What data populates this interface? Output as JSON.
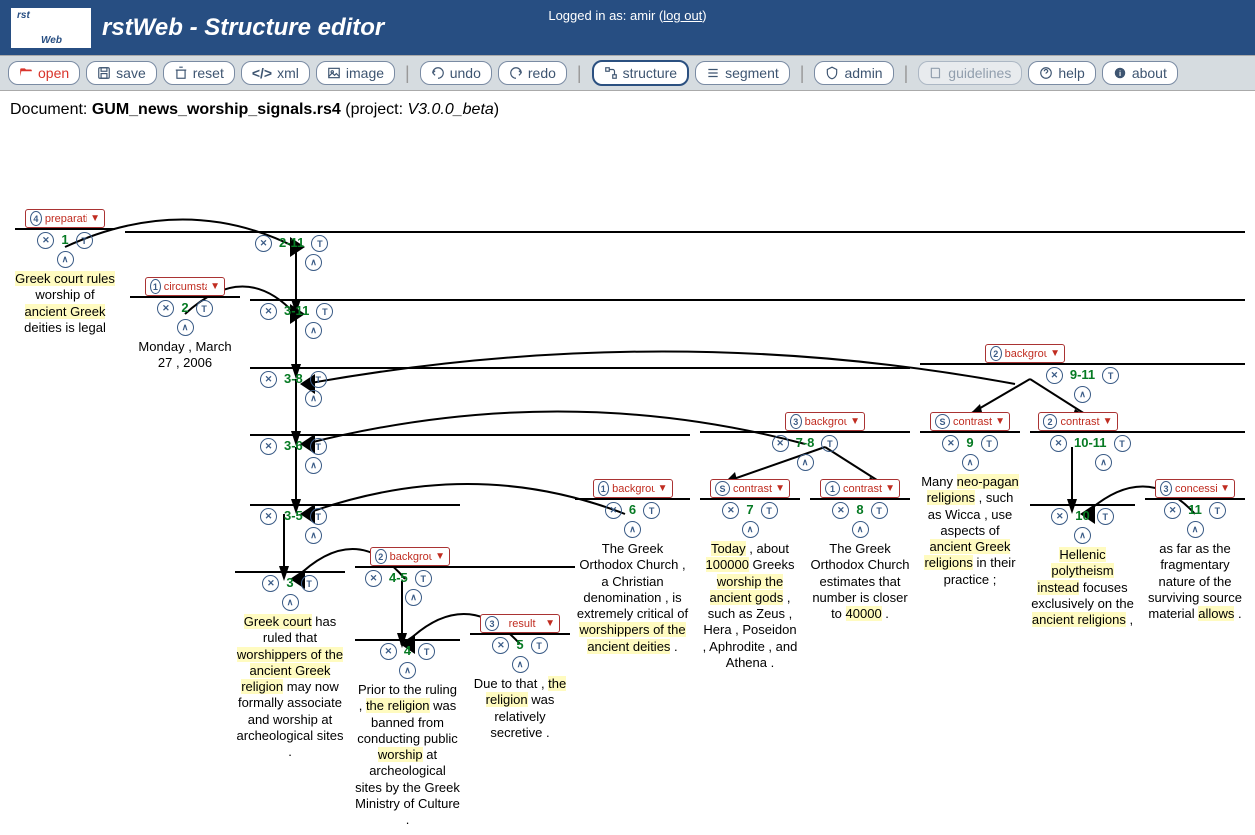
{
  "header": {
    "app_title": "rstWeb - Structure editor",
    "logged_in": "Logged in as: amir (",
    "logout": "log out",
    "close": ")"
  },
  "toolbar": {
    "open": "open",
    "save": "save",
    "reset": "reset",
    "xml": "xml",
    "image": "image",
    "undo": "undo",
    "redo": "redo",
    "structure": "structure",
    "segment": "segment",
    "admin": "admin",
    "guidelines": "guidelines",
    "help": "help",
    "about": "about"
  },
  "doc": {
    "label": "Document: ",
    "name": "GUM_news_worship_signals.rs4",
    "proj_label": " (project: ",
    "proj": "V3.0.0_beta",
    "close": ")"
  },
  "spans": {
    "s1": "1",
    "s2": "2",
    "s2_11": "2-11",
    "s3_11": "3-11",
    "s3_8": "3-8",
    "s9_11": "9-11",
    "s3_6": "3-6",
    "s7_8": "7-8",
    "s9": "9",
    "s10_11": "10-11",
    "s3_5": "3-5",
    "s6": "6",
    "s7": "7",
    "s8": "8",
    "s10": "10",
    "s11": "11",
    "s3": "3",
    "s4_5": "4-5",
    "s4": "4",
    "s5": "5"
  },
  "rel": {
    "preparation": "preparation",
    "circumstance": "circumstance",
    "background": "background",
    "contrast": "contrast",
    "concession": "concession",
    "result": "result"
  },
  "text": {
    "t1a": "Greek court rules",
    "t1b": " worship of ",
    "t1c": "ancient Greek",
    "t1d": " deities is legal",
    "t2": "Monday , March 27 , 2006",
    "t3a": "Greek court",
    "t3b": " has ruled that ",
    "t3c": "worshippers of the ancient Greek religion",
    "t3d": " may now formally associate and worship at archeological sites .",
    "t4a": "Prior to the ruling , ",
    "t4b": "the religion",
    "t4c": " was banned from conducting public ",
    "t4d": "worship",
    "t4e": " at archeological sites by the Greek Ministry of Culture .",
    "t5a": "Due to that , ",
    "t5b": "the religion",
    "t5c": " was relatively secretive .",
    "t6a": "The Greek Orthodox Church , a Christian denomination , is extremely critical of ",
    "t6b": "worshippers of the ancient deities",
    "t7a": "Today",
    "t7b": " , about ",
    "t7c": "100000",
    "t7d": " Greeks ",
    "t7e": "worship the ancient gods",
    "t7f": " , such as Zeus , Hera , Poseidon , Aphrodite , and Athena .",
    "t8a": "The Greek Orthodox Church estimates that number is closer to ",
    "t8b": "40000",
    "t8c": " .",
    "t9a": "Many ",
    "t9b": "neo-pagan religions",
    "t9c": " , such as Wicca , use aspects of ",
    "t9d": "ancient Greek religions",
    "t9e": " in their practice ;",
    "t10a": "Hellenic polytheism",
    "t10b": " instead",
    "t10c": " focuses exclusively on the ",
    "t10d": "ancient religions",
    "t10e": " ,",
    "t11a": "as far as the fragmentary nature of the surviving source material ",
    "t11b": "allows",
    "t11c": " ."
  }
}
